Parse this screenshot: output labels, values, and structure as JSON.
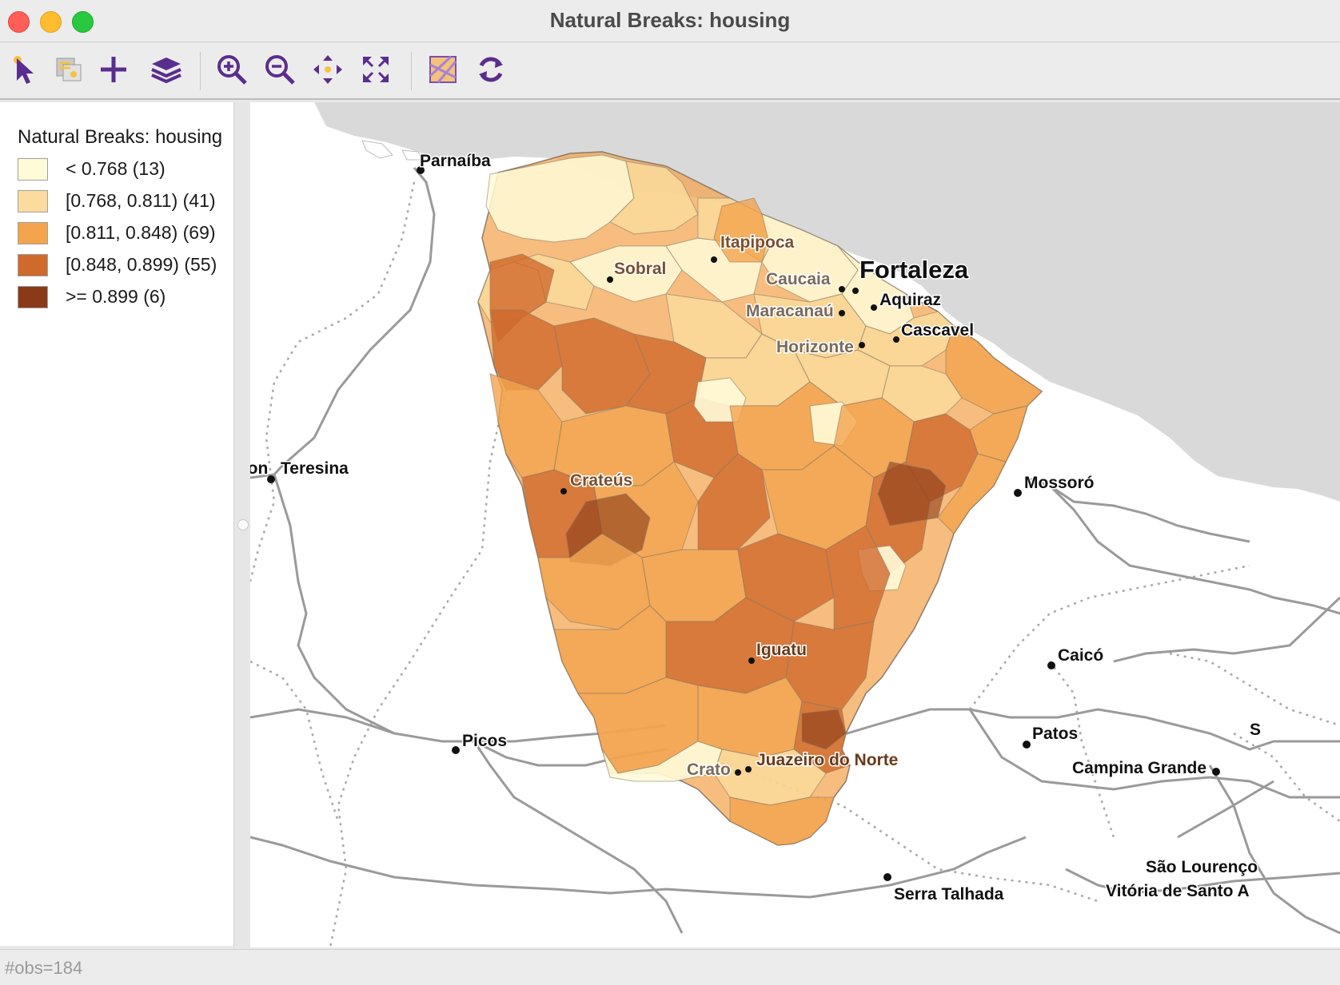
{
  "window": {
    "title": "Natural Breaks: housing"
  },
  "toolbar": {
    "tools": [
      {
        "name": "select-tool-icon"
      },
      {
        "name": "selection-shape-icon"
      },
      {
        "name": "add-icon"
      },
      {
        "name": "layers-icon"
      },
      {
        "name": "zoom-in-icon"
      },
      {
        "name": "zoom-out-icon"
      },
      {
        "name": "pan-icon"
      },
      {
        "name": "full-extent-icon"
      },
      {
        "name": "basemap-icon"
      },
      {
        "name": "refresh-icon"
      }
    ],
    "accent_color": "#5b2d8e"
  },
  "legend": {
    "title": "Natural Breaks: housing",
    "items": [
      {
        "label": "< 0.768 (13)",
        "color": "#fffbd8"
      },
      {
        "label": "[0.768, 0.811) (41)",
        "color": "#fbdc9e"
      },
      {
        "label": "[0.811, 0.848) (69)",
        "color": "#f3a44d"
      },
      {
        "label": "[0.848, 0.899) (55)",
        "color": "#d0692c"
      },
      {
        "label": ">= 0.899 (6)",
        "color": "#8b3a17"
      }
    ]
  },
  "map": {
    "cities": [
      {
        "name": "Parnaíba"
      },
      {
        "name": "Itapipoca"
      },
      {
        "name": "Sobral"
      },
      {
        "name": "Caucaia"
      },
      {
        "name": "Fortaleza"
      },
      {
        "name": "Aquiraz"
      },
      {
        "name": "Maracanaú"
      },
      {
        "name": "Cascavel"
      },
      {
        "name": "Horizonte"
      },
      {
        "name": "mon"
      },
      {
        "name": "Teresina"
      },
      {
        "name": "Crateús"
      },
      {
        "name": "Mossoró"
      },
      {
        "name": "Iguatu"
      },
      {
        "name": "Caicó"
      },
      {
        "name": "Patos"
      },
      {
        "name": "Picos"
      },
      {
        "name": "Crato"
      },
      {
        "name": "Juazeiro do Norte"
      },
      {
        "name": "Campina Grande"
      },
      {
        "name": "S"
      },
      {
        "name": "São Lourenço"
      },
      {
        "name": "Serra Talhada"
      },
      {
        "name": "Vitória de Santo A"
      }
    ],
    "colors": {
      "ocean": "#d9d9d9",
      "land": "#ffffff",
      "roads": "#9a9a9a",
      "borders": "#a8a8a8"
    }
  },
  "status": {
    "text": "#obs=184"
  }
}
